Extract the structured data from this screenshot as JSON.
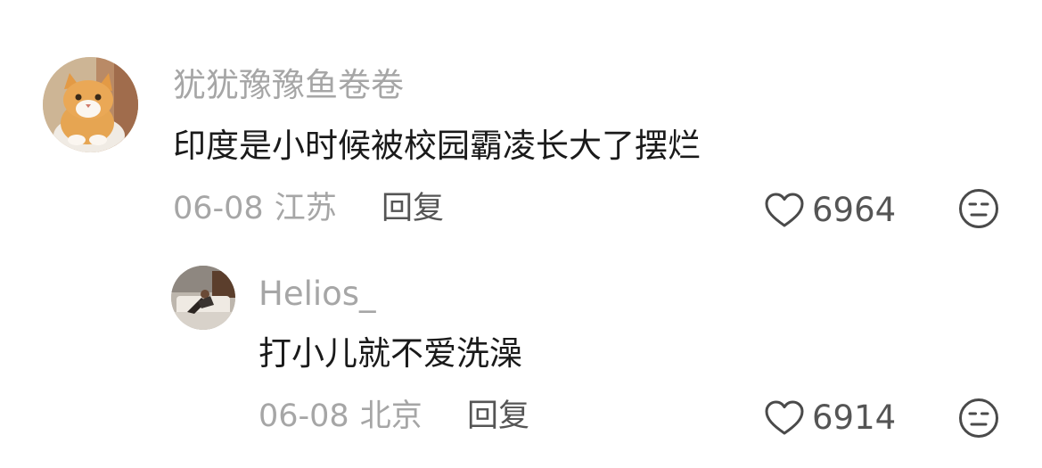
{
  "colors": {
    "username": "#a6a6a6",
    "meta": "#a6a6a6",
    "reply": "#555555",
    "text": "#1a1a1a",
    "icon": "#4a4a4a"
  },
  "comments": [
    {
      "username": "犹犹豫豫鱼卷卷",
      "avatar_icon": "orange-cat-avatar",
      "text": "印度是小时候被校园霸凌长大了摆烂",
      "date": "06-08",
      "location": "江苏",
      "reply_label": "回复",
      "like_icon": "heart-icon",
      "likes": "6964",
      "dislike_icon": "meh-face-icon"
    },
    {
      "username": "Helios_",
      "avatar_icon": "person-on-sofa-avatar",
      "text": "打小儿就不爱洗澡",
      "date": "06-08",
      "location": "北京",
      "reply_label": "回复",
      "like_icon": "heart-icon",
      "likes": "6914",
      "dislike_icon": "meh-face-icon"
    }
  ]
}
